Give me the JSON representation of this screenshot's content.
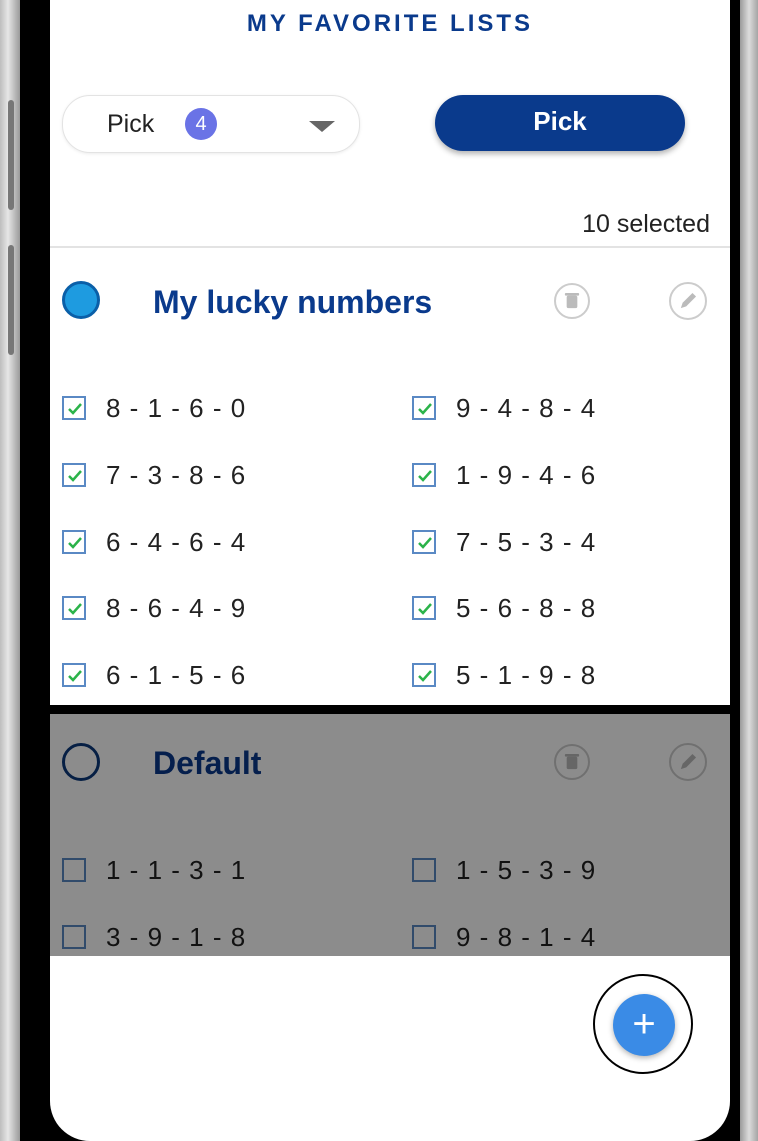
{
  "page": {
    "title": "MY FAVORITE LISTS"
  },
  "controls": {
    "pick_select_label": "Pick",
    "pick_select_badge": "4",
    "pick_button_label": "Pick",
    "selected_count": "10 selected"
  },
  "lists": [
    {
      "name": "My lucky numbers",
      "selected": true,
      "numbers": [
        {
          "value": "8 - 1 - 6 - 0",
          "checked": true
        },
        {
          "value": "9 - 4 - 8 - 4",
          "checked": true
        },
        {
          "value": "7 - 3 - 8 - 6",
          "checked": true
        },
        {
          "value": "1 - 9 - 4 - 6",
          "checked": true
        },
        {
          "value": "6 - 4 - 6 - 4",
          "checked": true
        },
        {
          "value": "7 - 5 - 3 - 4",
          "checked": true
        },
        {
          "value": "8 - 6 - 4 - 9",
          "checked": true
        },
        {
          "value": "5 - 6 - 8 - 8",
          "checked": true
        },
        {
          "value": "6 - 1 - 5 - 6",
          "checked": true
        },
        {
          "value": "5 - 1 - 9 - 8",
          "checked": true
        }
      ]
    },
    {
      "name": "Default",
      "selected": false,
      "numbers": [
        {
          "value": "1 - 1 - 3 - 1",
          "checked": false
        },
        {
          "value": "1 - 5 - 3 - 9",
          "checked": false
        },
        {
          "value": "3 - 9 - 1 - 8",
          "checked": false
        },
        {
          "value": "9 - 8 - 1 - 4",
          "checked": false
        }
      ]
    }
  ],
  "fab": {
    "label": "+"
  },
  "colors": {
    "brand_blue": "#0a3a8c",
    "radio_selected": "#1e9be0",
    "check_green": "#2bb34a",
    "badge_purple": "#6a73e6",
    "fab_blue": "#3a8be6"
  }
}
